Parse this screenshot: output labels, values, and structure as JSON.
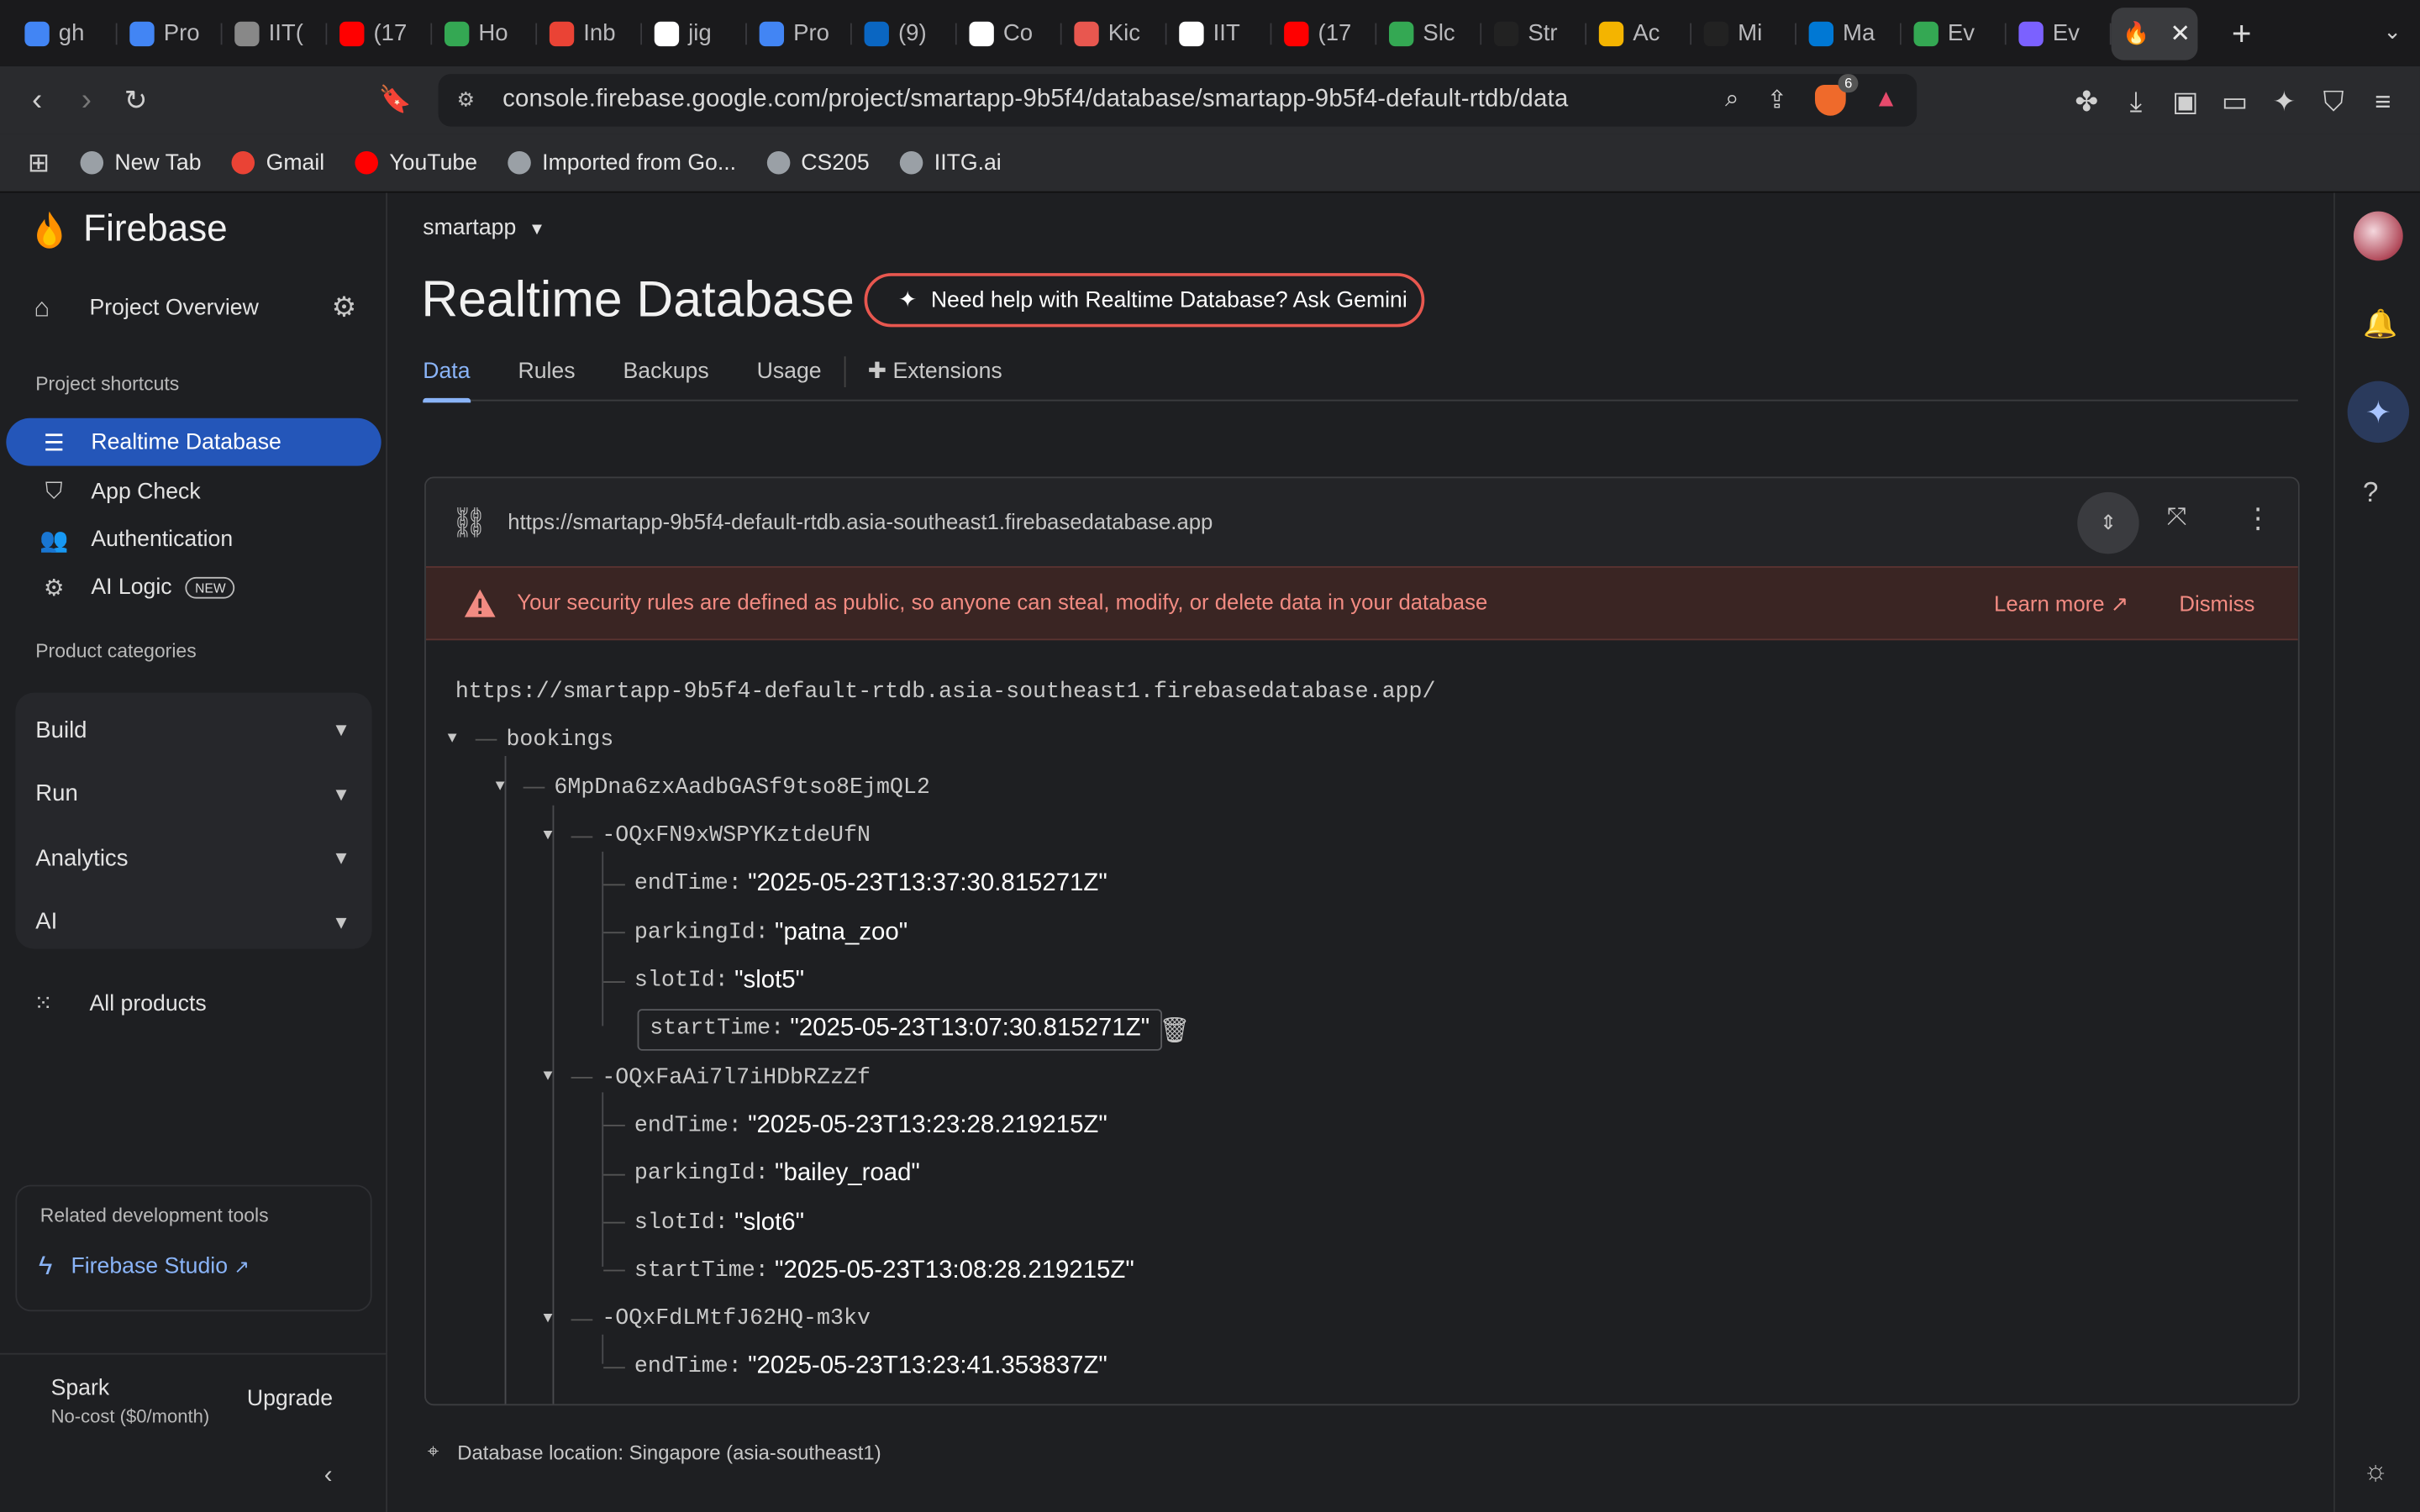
{
  "browser": {
    "tabs": [
      {
        "label": "gh",
        "color": "#4285f4"
      },
      {
        "label": "Pro",
        "color": "#4285f4"
      },
      {
        "label": "IIT(",
        "color": "#888888"
      },
      {
        "label": "(17",
        "color": "#ff0000"
      },
      {
        "label": "Ho",
        "color": "#34a853"
      },
      {
        "label": "Inb",
        "color": "#ea4335"
      },
      {
        "label": "jig",
        "color": "#ffffff"
      },
      {
        "label": "Pro",
        "color": "#4285f4"
      },
      {
        "label": "(9)",
        "color": "#0a66c2"
      },
      {
        "label": "Co",
        "color": "#ffffff"
      },
      {
        "label": "Kic",
        "color": "#e8574f"
      },
      {
        "label": "IIT",
        "color": "#ffffff"
      },
      {
        "label": "(17",
        "color": "#ff0000"
      },
      {
        "label": "Slc",
        "color": "#34a853"
      },
      {
        "label": "Str",
        "color": "#222222"
      },
      {
        "label": "Ac",
        "color": "#f4b400"
      },
      {
        "label": "Mi",
        "color": "#222222"
      },
      {
        "label": "Ma",
        "color": "#0078d4"
      },
      {
        "label": "Ev",
        "color": "#34a853"
      },
      {
        "label": "Ev",
        "color": "#7b61ff"
      }
    ],
    "active_tab_close": "✕",
    "new_tab": "+",
    "url": "console.firebase.google.com/project/smartapp-9b5f4/database/smartapp-9b5f4-default-rtdb/data",
    "brave_count": "6",
    "bookmarks": [
      {
        "label": "New Tab",
        "color": "#9aa0a6"
      },
      {
        "label": "Gmail",
        "color": "#ea4335"
      },
      {
        "label": "YouTube",
        "color": "#ff0000"
      },
      {
        "label": "Imported from Go...",
        "color": "#9aa0a6"
      },
      {
        "label": "CS205",
        "color": "#9aa0a6"
      },
      {
        "label": "IITG.ai",
        "color": "#9aa0a6"
      }
    ]
  },
  "sidebar": {
    "brand": "Firebase",
    "project_overview": "Project Overview",
    "shortcuts_label": "Project shortcuts",
    "shortcuts": [
      {
        "label": "Realtime Database",
        "icon": "database-icon",
        "active": true
      },
      {
        "label": "App Check",
        "icon": "shield-icon",
        "active": false
      },
      {
        "label": "Authentication",
        "icon": "people-icon",
        "active": false
      },
      {
        "label": "AI Logic",
        "icon": "ai-logic-icon",
        "active": false,
        "badge": "NEW"
      }
    ],
    "categories_label": "Product categories",
    "categories": [
      "Build",
      "Run",
      "Analytics",
      "AI"
    ],
    "all_products": "All products",
    "dev_tools_label": "Related development tools",
    "firebase_studio": "Firebase Studio",
    "plan_name": "Spark",
    "plan_sub": "No-cost ($0/month)",
    "upgrade": "Upgrade"
  },
  "main": {
    "project": "smartapp",
    "title": "Realtime Database",
    "gemini_button": "Need help with Realtime Database? Ask Gemini",
    "tabs": [
      "Data",
      "Rules",
      "Backups",
      "Usage",
      "Extensions"
    ],
    "active_tab": "Data",
    "db_url": "https://smartapp-9b5f4-default-rtdb.asia-southeast1.firebasedatabase.app",
    "warning": "Your security rules are defined as public, so anyone can steal, modify, or delete data in your database",
    "learn_more": "Learn more",
    "dismiss": "Dismiss",
    "root_url": "https://smartapp-9b5f4-default-rtdb.asia-southeast1.firebasedatabase.app/",
    "tree": {
      "root_key": "bookings",
      "user_key": "6MpDna6zxAadbGASf9tso8EjmQL2",
      "entries": [
        {
          "key": "-OQxFN9xWSPYKztdeUfN",
          "fields": [
            {
              "k": "endTime:",
              "v": "\"2025-05-23T13:37:30.815271Z\""
            },
            {
              "k": "parkingId:",
              "v": "\"patna_zoo\""
            },
            {
              "k": "slotId:",
              "v": "\"slot5\""
            },
            {
              "k": "startTime:",
              "v": "\"2025-05-23T13:07:30.815271Z\""
            }
          ]
        },
        {
          "key": "-OQxFaAi7l7iHDbRZzZf",
          "fields": [
            {
              "k": "endTime:",
              "v": "\"2025-05-23T13:23:28.219215Z\""
            },
            {
              "k": "parkingId:",
              "v": "\"bailey_road\""
            },
            {
              "k": "slotId:",
              "v": "\"slot6\""
            },
            {
              "k": "startTime:",
              "v": "\"2025-05-23T13:08:28.219215Z\""
            }
          ]
        },
        {
          "key": "-OQxFdLMtfJ62HQ-m3kv",
          "fields": [
            {
              "k": "endTime:",
              "v": "\"2025-05-23T13:23:41.353837Z\""
            }
          ]
        }
      ]
    },
    "db_location": "Database location: Singapore (asia-southeast1)"
  }
}
